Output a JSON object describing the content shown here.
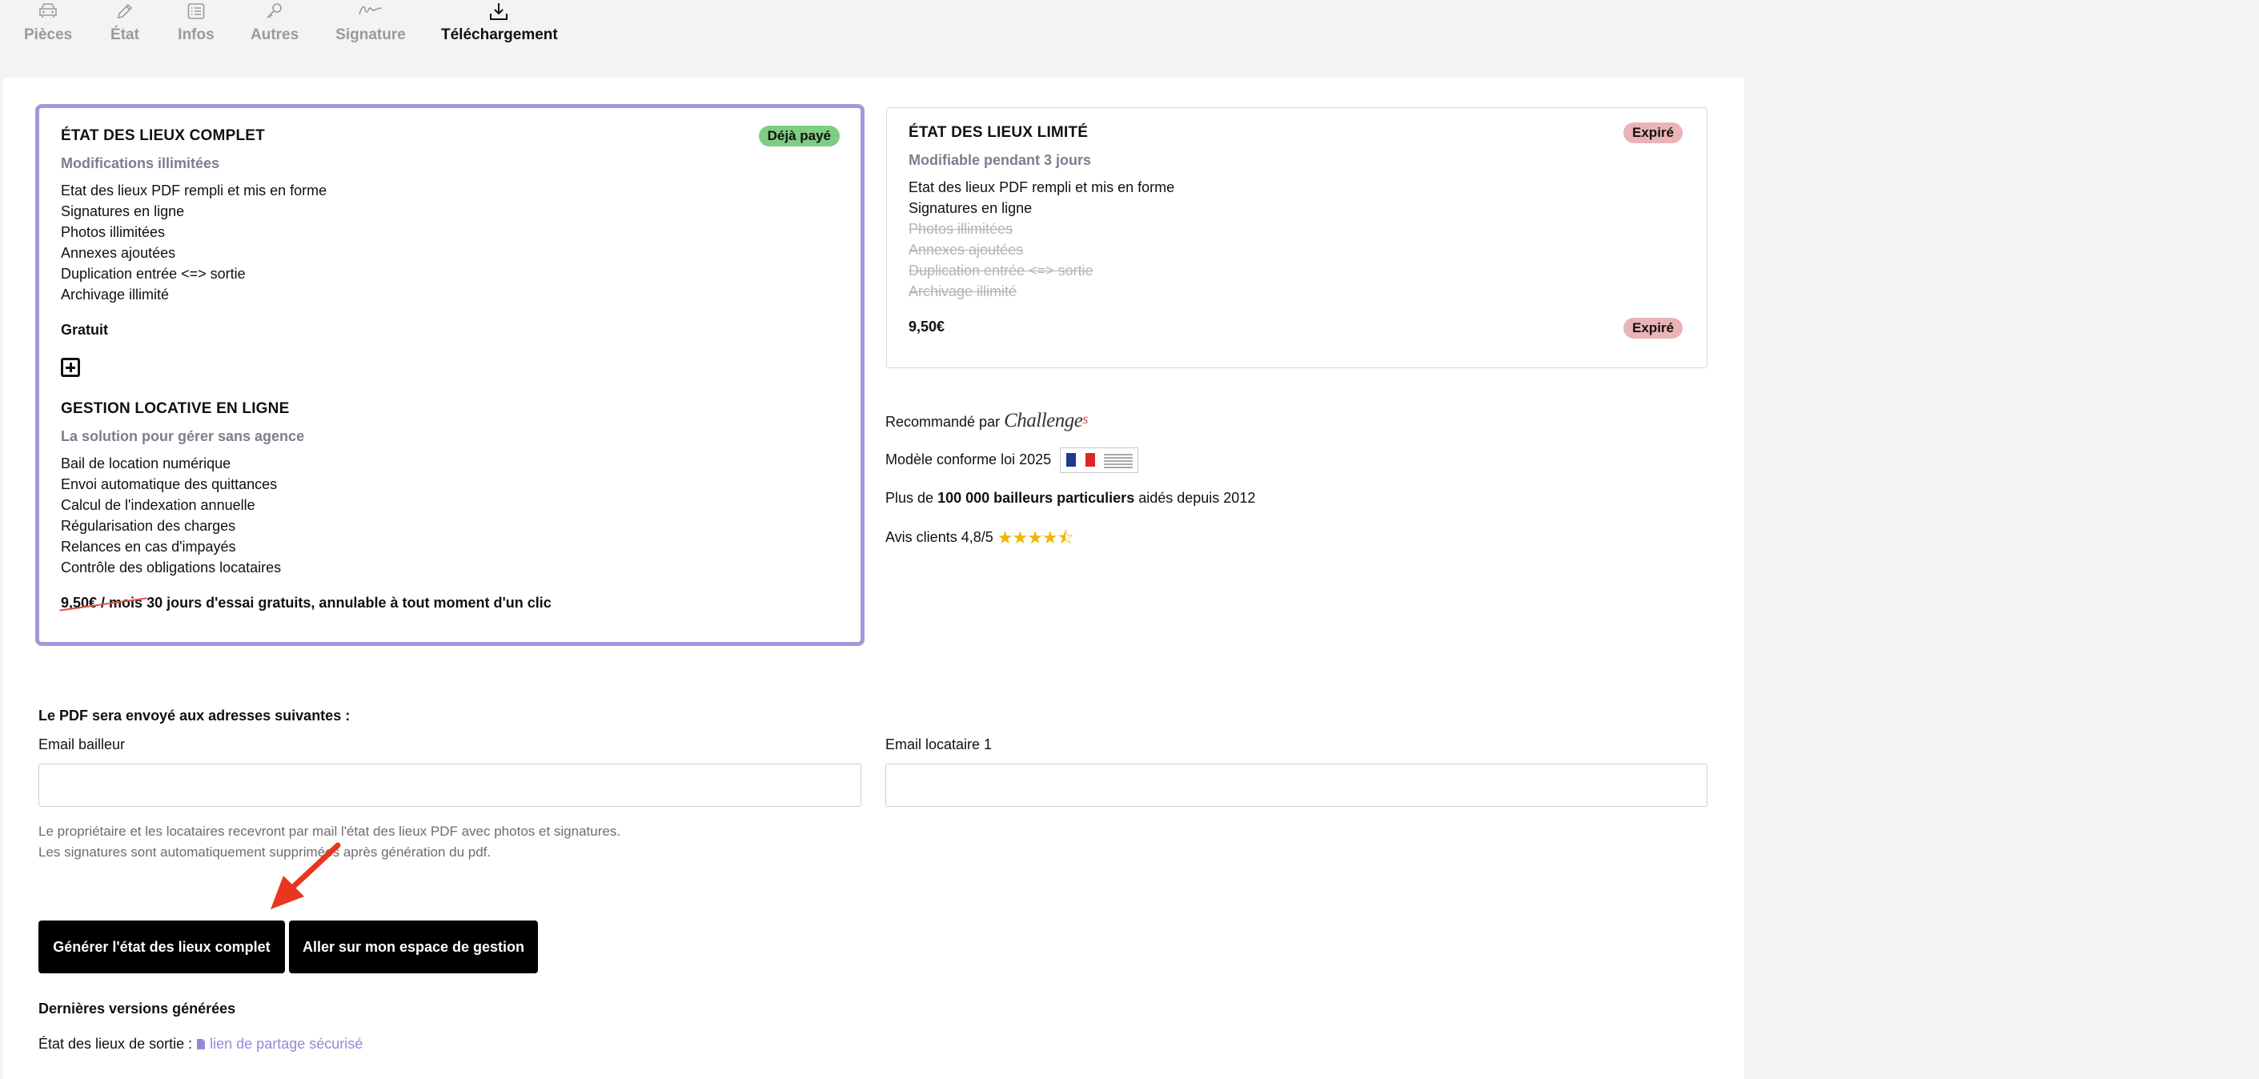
{
  "tabs": [
    {
      "label": "Pièces",
      "icon": "car-icon"
    },
    {
      "label": "État",
      "icon": "pencil-icon"
    },
    {
      "label": "Infos",
      "icon": "list-icon"
    },
    {
      "label": "Autres",
      "icon": "key-icon"
    },
    {
      "label": "Signature",
      "icon": "signature-icon"
    },
    {
      "label": "Téléchargement",
      "icon": "download-icon",
      "active": true
    }
  ],
  "offer_full": {
    "title": "ÉTAT DES LIEUX COMPLET",
    "badge": "Déjà payé",
    "subtitle": "Modifications illimitées",
    "features": [
      "Etat des lieux PDF rempli et mis en forme",
      "Signatures en ligne",
      "Photos illimitées",
      "Annexes ajoutées",
      "Duplication entrée <=> sortie",
      "Archivage illimité"
    ],
    "price": "Gratuit",
    "addon": {
      "title": "GESTION LOCATIVE EN LIGNE",
      "subtitle": "La solution pour gérer sans agence",
      "features": [
        "Bail de location numérique",
        "Envoi automatique des quittances",
        "Calcul de l'indexation annuelle",
        "Régularisation des charges",
        "Relances en cas d'impayés",
        "Contrôle des obligations locataires"
      ],
      "old_price": "9,50€ / mois",
      "offer": "30 jours d'essai gratuits, annulable à tout moment d'un clic"
    }
  },
  "offer_limited": {
    "title": "ÉTAT DES LIEUX LIMITÉ",
    "badge": "Expiré",
    "subtitle": "Modifiable pendant 3 jours",
    "features": [
      "Etat des lieux PDF rempli et mis en forme",
      "Signatures en ligne"
    ],
    "struck_features": [
      "Photos illimitées",
      "Annexes ajoutées",
      "Duplication entrée <=> sortie",
      "Archivage illimité"
    ],
    "price": "9,50€",
    "price_badge": "Expiré"
  },
  "trust": {
    "recommended_prefix": "Recommandé par",
    "recommended_brand": "Challenge",
    "recommended_brand_suffix": "s",
    "conform": "Modèle conforme loi 2025",
    "users_prefix": "Plus de",
    "users_bold": "100 000 bailleurs particuliers",
    "users_suffix": "aidés depuis 2012",
    "reviews": "Avis clients 4,8/5",
    "rating": 4.5
  },
  "emails": {
    "heading": "Le PDF sera envoyé aux adresses suivantes :",
    "landlord_label": "Email bailleur",
    "landlord_value": "",
    "tenant_label": "Email locataire 1",
    "tenant_value": "",
    "note_line1": "Le propriétaire et les locataires recevront par mail l'état des lieux PDF avec photos et signatures.",
    "note_line2": "Les signatures sont automatiquement supprimées après génération du pdf."
  },
  "actions": {
    "generate": "Générer l'état des lieux complet",
    "management": "Aller sur mon espace de gestion"
  },
  "versions": {
    "heading": "Dernières versions générées",
    "item_label": "État des lieux de sortie :",
    "item_link": "lien de partage sécurisé"
  },
  "colors": {
    "accent_border": "#a996d9",
    "paid_badge": "#7fcd83",
    "expired_badge": "#eab3b6",
    "link": "#9a86d6",
    "arrow": "#e8361f"
  }
}
